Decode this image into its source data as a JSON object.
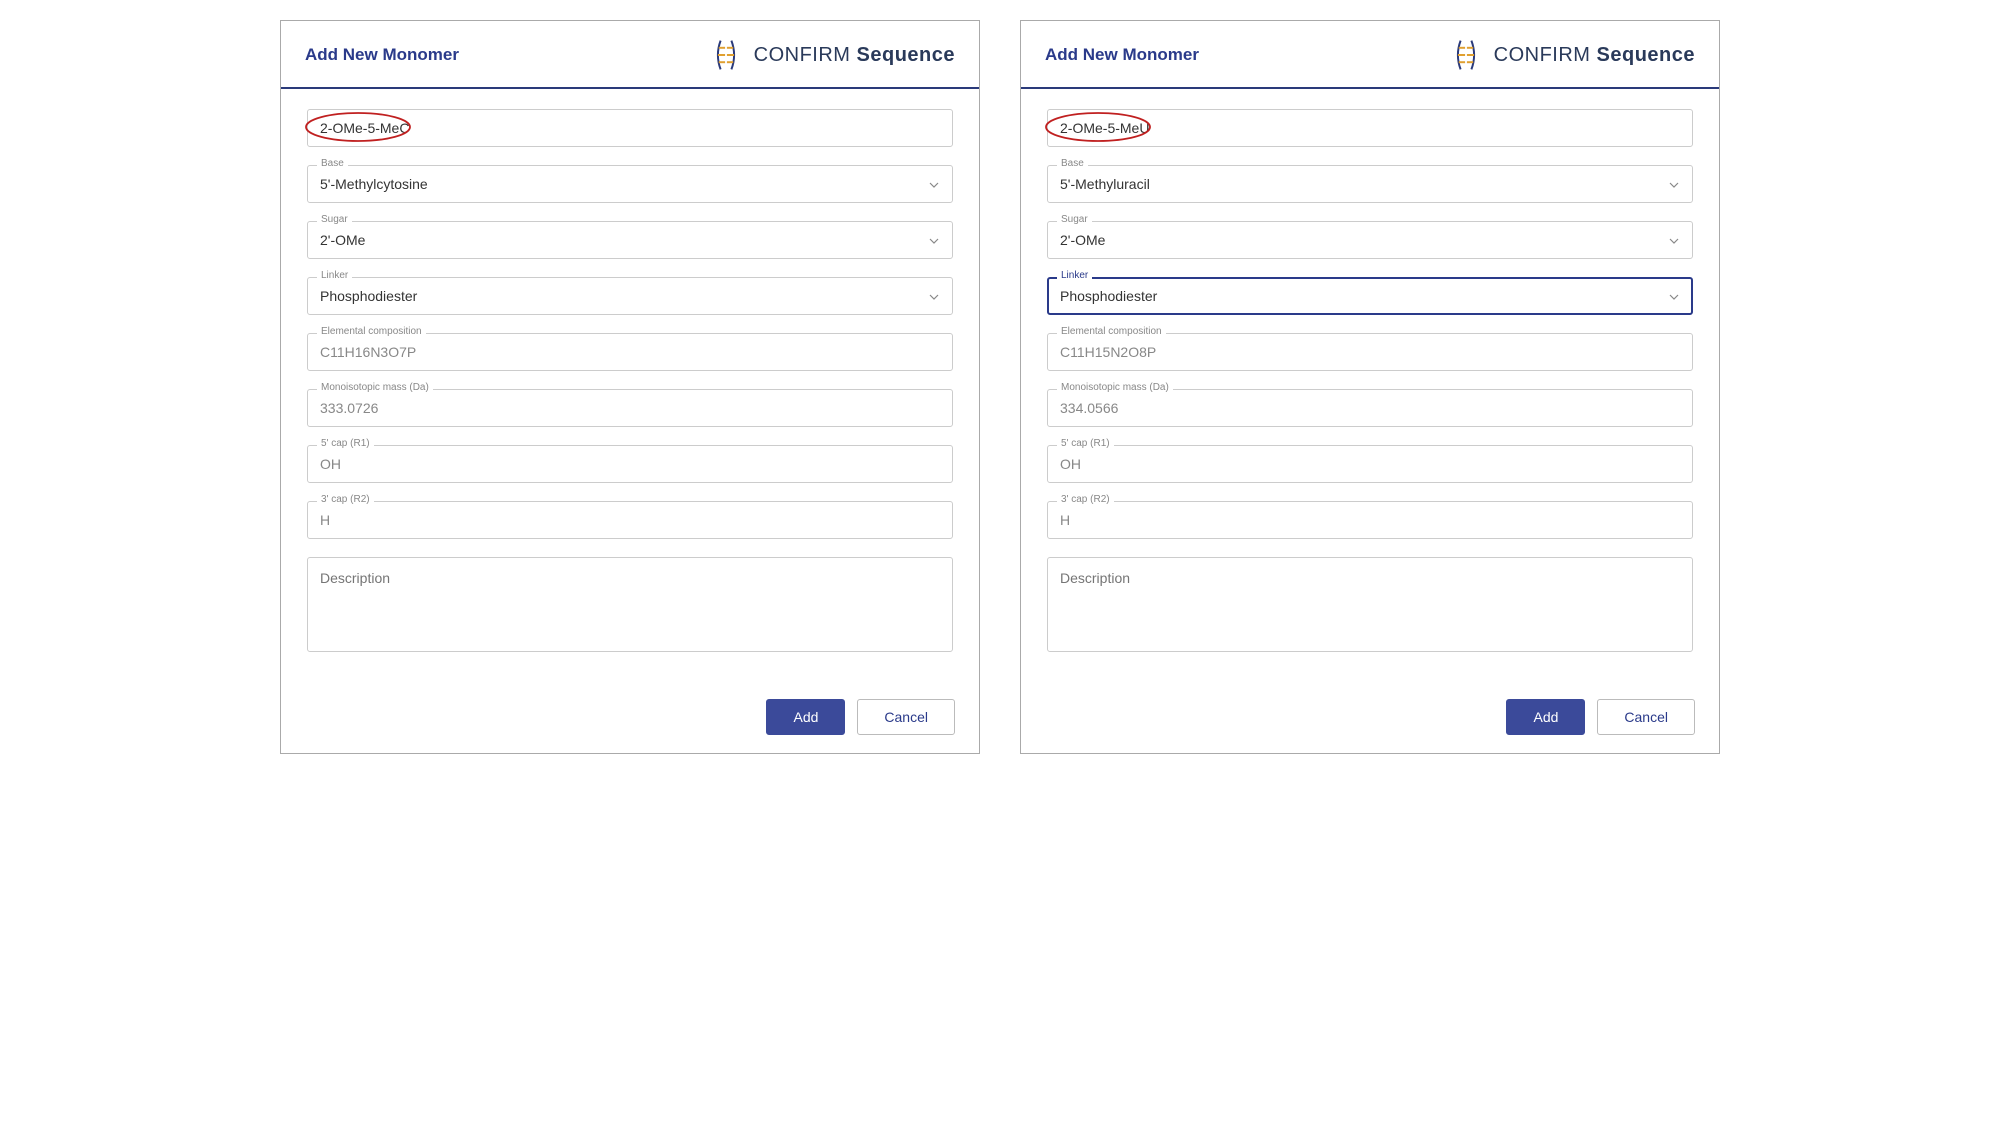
{
  "logo": {
    "confirm": "CONFIRM",
    "sequence": "Sequence"
  },
  "panels": [
    {
      "title": "Add New Monomer",
      "fields": {
        "id": {
          "label": "",
          "value": "2-OMe-5-MeC",
          "circled": true
        },
        "base": {
          "label": "Base",
          "value": "5'-Methylcytosine"
        },
        "sugar": {
          "label": "Sugar",
          "value": "2'-OMe"
        },
        "linker": {
          "label": "Linker",
          "value": "Phosphodiester",
          "focused": false
        },
        "comp": {
          "label": "Elemental composition",
          "value": "C11H16N3O7P"
        },
        "mass": {
          "label": "Monoisotopic mass (Da)",
          "value": "333.0726"
        },
        "cap5": {
          "label": "5' cap (R1)",
          "value": "OH"
        },
        "cap3": {
          "label": "3' cap (R2)",
          "value": "H"
        },
        "desc": {
          "placeholder": "Description"
        }
      },
      "buttons": {
        "add": "Add",
        "cancel": "Cancel"
      }
    },
    {
      "title": "Add New Monomer",
      "fields": {
        "id": {
          "label": "",
          "value": "2-OMe-5-MeU",
          "circled": true
        },
        "base": {
          "label": "Base",
          "value": "5'-Methyluracil"
        },
        "sugar": {
          "label": "Sugar",
          "value": "2'-OMe"
        },
        "linker": {
          "label": "Linker",
          "value": "Phosphodiester",
          "focused": true
        },
        "comp": {
          "label": "Elemental composition",
          "value": "C11H15N2O8P"
        },
        "mass": {
          "label": "Monoisotopic mass (Da)",
          "value": "334.0566"
        },
        "cap5": {
          "label": "5' cap (R1)",
          "value": "OH"
        },
        "cap3": {
          "label": "3' cap (R2)",
          "value": "H"
        },
        "desc": {
          "placeholder": "Description"
        }
      },
      "buttons": {
        "add": "Add",
        "cancel": "Cancel"
      }
    }
  ]
}
